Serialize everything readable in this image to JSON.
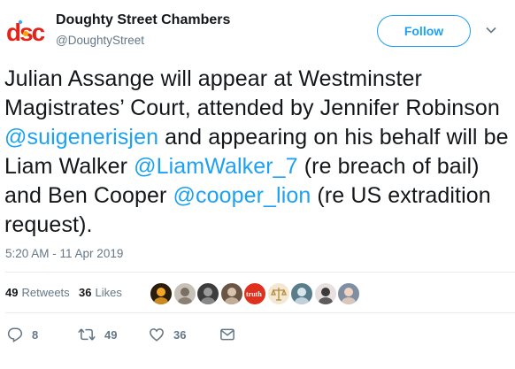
{
  "author": {
    "logo_text": "dsc",
    "name": "Doughty Street Chambers",
    "handle": "@DoughtyStreet"
  },
  "follow_label": "Follow",
  "tweet": {
    "parts": [
      {
        "text": "Julian Assange will appear at Westminster Magistrates’ Court, attended by Jennifer Robinson ",
        "type": "text"
      },
      {
        "text": "@suigenerisjen",
        "type": "mention"
      },
      {
        "text": " and appearing on his behalf will be Liam Walker ",
        "type": "text"
      },
      {
        "text": "@LiamWalker_7",
        "type": "mention"
      },
      {
        "text": " (re breach of bail) and Ben Cooper ",
        "type": "text"
      },
      {
        "text": "@cooper_lion",
        "type": "mention"
      },
      {
        "text": " (re US extradition request).",
        "type": "text"
      }
    ]
  },
  "timestamp": "5:20 AM - 11 Apr 2019",
  "stats": {
    "retweets_count": "49",
    "retweets_label": "Retweets",
    "likes_count": "36",
    "likes_label": "Likes"
  },
  "avatars": [
    {
      "name": "avatar-1",
      "color": "#2b1d0e",
      "accent": "#f5a623"
    },
    {
      "name": "avatar-2",
      "color": "#c7c1b8",
      "accent": "#7a6f63"
    },
    {
      "name": "avatar-3",
      "color": "#3d3d3d",
      "accent": "#9b9b9b"
    },
    {
      "name": "avatar-4",
      "color": "#6b5646",
      "accent": "#d8c3ae"
    },
    {
      "name": "avatar-5",
      "color": "#e0301e",
      "accent": "#ffffff"
    },
    {
      "name": "avatar-6",
      "color": "#f3e9d2",
      "accent": "#b58a3c"
    },
    {
      "name": "avatar-7",
      "color": "#5a7d8c",
      "accent": "#d9e6ec"
    },
    {
      "name": "avatar-8",
      "color": "#e8e0e0",
      "accent": "#3a3a3a"
    },
    {
      "name": "avatar-9",
      "color": "#7f8fa3",
      "accent": "#f1d5c0"
    }
  ],
  "avatar_logo_text": "truth",
  "actions": {
    "replies": "8",
    "retweets": "49",
    "likes": "36"
  },
  "colors": {
    "accent": "#1da1f2",
    "text": "#14171a",
    "muted": "#657786",
    "divider": "#e6ecf0"
  },
  "icons": [
    "logo-icon",
    "chevron-down-icon",
    "reply-icon",
    "retweet-icon",
    "like-icon",
    "message-icon"
  ]
}
